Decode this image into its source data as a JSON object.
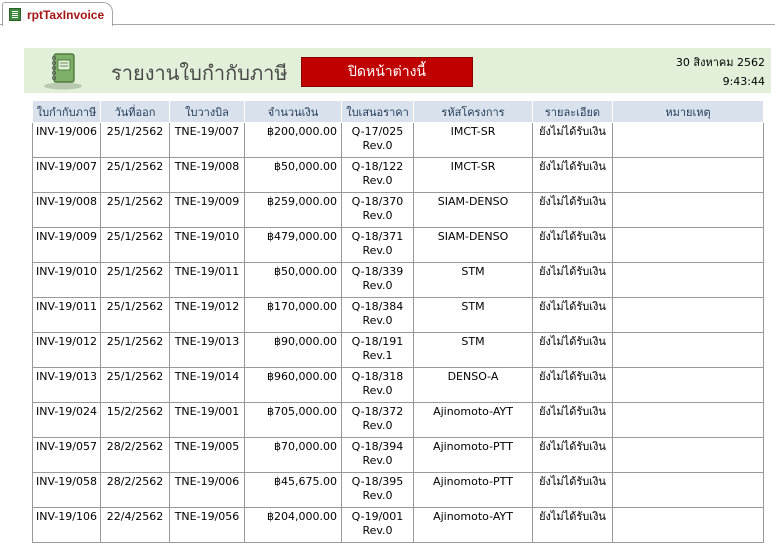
{
  "tab": {
    "label": "rptTaxInvoice"
  },
  "header": {
    "title": "รายงานใบกำกับภาษี",
    "close_button": "ปิดหน้าต่างนี้",
    "date": "30 สิงหาคม 2562",
    "time": "9:43:44"
  },
  "columns": [
    "ใบกำกับภาษี",
    "วันที่ออก",
    "ใบวางบิล",
    "จำนวนเงิน",
    "ใบเสนอราคา",
    "รหัสโครงการ",
    "รายละเอียด",
    "หมายเหตุ"
  ],
  "rows": [
    {
      "invoice": "INV-19/006",
      "date": "25/1/2562",
      "bill": "TNE-19/007",
      "amount": "฿200,000.00",
      "quote": "Q-17/025",
      "rev": "Rev.0",
      "project": "IMCT-SR",
      "detail": "ยังไม่ได้รับเงิน",
      "note": ""
    },
    {
      "invoice": "INV-19/007",
      "date": "25/1/2562",
      "bill": "TNE-19/008",
      "amount": "฿50,000.00",
      "quote": "Q-18/122",
      "rev": "Rev.0",
      "project": "IMCT-SR",
      "detail": "ยังไม่ได้รับเงิน",
      "note": ""
    },
    {
      "invoice": "INV-19/008",
      "date": "25/1/2562",
      "bill": "TNE-19/009",
      "amount": "฿259,000.00",
      "quote": "Q-18/370",
      "rev": "Rev.0",
      "project": "SIAM-DENSO",
      "detail": "ยังไม่ได้รับเงิน",
      "note": ""
    },
    {
      "invoice": "INV-19/009",
      "date": "25/1/2562",
      "bill": "TNE-19/010",
      "amount": "฿479,000.00",
      "quote": "Q-18/371",
      "rev": "Rev.0",
      "project": "SIAM-DENSO",
      "detail": "ยังไม่ได้รับเงิน",
      "note": ""
    },
    {
      "invoice": "INV-19/010",
      "date": "25/1/2562",
      "bill": "TNE-19/011",
      "amount": "฿50,000.00",
      "quote": "Q-18/339",
      "rev": "Rev.0",
      "project": "STM",
      "detail": "ยังไม่ได้รับเงิน",
      "note": ""
    },
    {
      "invoice": "INV-19/011",
      "date": "25/1/2562",
      "bill": "TNE-19/012",
      "amount": "฿170,000.00",
      "quote": "Q-18/384",
      "rev": "Rev.0",
      "project": "STM",
      "detail": "ยังไม่ได้รับเงิน",
      "note": ""
    },
    {
      "invoice": "INV-19/012",
      "date": "25/1/2562",
      "bill": "TNE-19/013",
      "amount": "฿90,000.00",
      "quote": "Q-18/191",
      "rev": "Rev.1",
      "project": "STM",
      "detail": "ยังไม่ได้รับเงิน",
      "note": ""
    },
    {
      "invoice": "INV-19/013",
      "date": "25/1/2562",
      "bill": "TNE-19/014",
      "amount": "฿960,000.00",
      "quote": "Q-18/318",
      "rev": "Rev.0",
      "project": "DENSO-A",
      "detail": "ยังไม่ได้รับเงิน",
      "note": ""
    },
    {
      "invoice": "INV-19/024",
      "date": "15/2/2562",
      "bill": "TNE-19/001",
      "amount": "฿705,000.00",
      "quote": "Q-18/372",
      "rev": "Rev.0",
      "project": "Ajinomoto-AYT",
      "detail": "ยังไม่ได้รับเงิน",
      "note": ""
    },
    {
      "invoice": "INV-19/057",
      "date": "28/2/2562",
      "bill": "TNE-19/005",
      "amount": "฿70,000.00",
      "quote": "Q-18/394",
      "rev": "Rev.0",
      "project": "Ajinomoto-PTT",
      "detail": "ยังไม่ได้รับเงิน",
      "note": ""
    },
    {
      "invoice": "INV-19/058",
      "date": "28/2/2562",
      "bill": "TNE-19/006",
      "amount": "฿45,675.00",
      "quote": "Q-18/395",
      "rev": "Rev.0",
      "project": "Ajinomoto-PTT",
      "detail": "ยังไม่ได้รับเงิน",
      "note": ""
    },
    {
      "invoice": "INV-19/106",
      "date": "22/4/2562",
      "bill": "TNE-19/056",
      "amount": "฿204,000.00",
      "quote": "Q-19/001",
      "rev": "Rev.0",
      "project": "Ajinomoto-AYT",
      "detail": "ยังไม่ได้รับเงิน",
      "note": ""
    }
  ]
}
